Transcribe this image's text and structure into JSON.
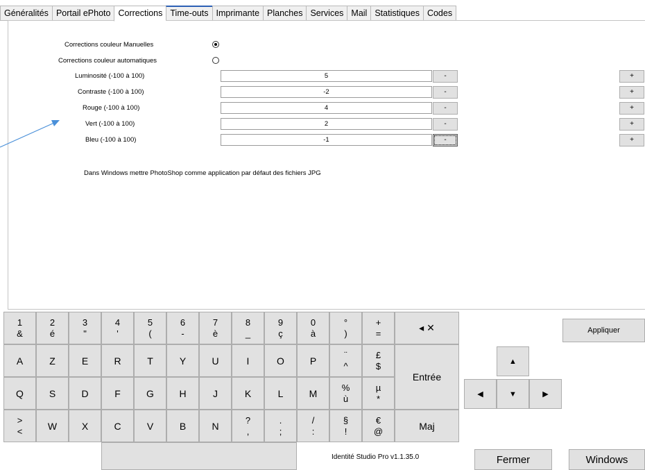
{
  "tabs": [
    {
      "label": "Généralités"
    },
    {
      "label": "Portail ePhoto"
    },
    {
      "label": "Corrections"
    },
    {
      "label": "Time-outs"
    },
    {
      "label": "Imprimante"
    },
    {
      "label": "Planches"
    },
    {
      "label": "Services"
    },
    {
      "label": "Mail"
    },
    {
      "label": "Statistiques"
    },
    {
      "label": "Codes"
    }
  ],
  "active_tab": "Corrections",
  "corrections": {
    "manual_label": "Corrections couleur Manuelles",
    "auto_label": "Corrections couleur automatiques",
    "mode_selected": "manual",
    "rows": [
      {
        "label": "Luminosité (-100 à 100)",
        "value": "5",
        "minus": "-",
        "plus": "+"
      },
      {
        "label": "Contraste (-100 à 100)",
        "value": "-2",
        "minus": "-",
        "plus": "+"
      },
      {
        "label": "Rouge (-100 à 100)",
        "value": "4",
        "minus": "-",
        "plus": "+"
      },
      {
        "label": "Vert (-100 à 100)",
        "value": "2",
        "minus": "-",
        "plus": "+"
      },
      {
        "label": "Bleu (-100 à 100)",
        "value": "-1",
        "minus": "-",
        "plus": "+"
      }
    ],
    "note": "Dans Windows mettre PhotoShop comme application par défaut des fichiers JPG"
  },
  "keyboard": {
    "row1": [
      {
        "top": "1",
        "bottom": "&"
      },
      {
        "top": "2",
        "bottom": "é"
      },
      {
        "top": "3",
        "bottom": "\""
      },
      {
        "top": "4",
        "bottom": "'"
      },
      {
        "top": "5",
        "bottom": "("
      },
      {
        "top": "6",
        "bottom": "-"
      },
      {
        "top": "7",
        "bottom": "è"
      },
      {
        "top": "8",
        "bottom": "_"
      },
      {
        "top": "9",
        "bottom": "ç"
      },
      {
        "top": "0",
        "bottom": "à"
      },
      {
        "top": "°",
        "bottom": ")"
      },
      {
        "top": "+",
        "bottom": "="
      }
    ],
    "backspace": "◂ ✕",
    "row2": [
      "A",
      "Z",
      "E",
      "R",
      "T",
      "Y",
      "U",
      "I",
      "O",
      "P"
    ],
    "row2_extra": [
      {
        "top": "¨",
        "bottom": "^"
      },
      {
        "top": "£",
        "bottom": "$"
      }
    ],
    "row3": [
      "Q",
      "S",
      "D",
      "F",
      "G",
      "H",
      "J",
      "K",
      "L",
      "M"
    ],
    "row3_extra": [
      {
        "top": "%",
        "bottom": "ù"
      },
      {
        "top": "µ",
        "bottom": "*"
      }
    ],
    "enter": "Entrée",
    "row4_first": {
      "top": ">",
      "bottom": "<"
    },
    "row4": [
      "W",
      "X",
      "C",
      "V",
      "B",
      "N"
    ],
    "row4_extra": [
      {
        "top": "?",
        "bottom": ","
      },
      {
        "top": ".",
        "bottom": ";"
      },
      {
        "top": "/",
        "bottom": ":"
      },
      {
        "top": "§",
        "bottom": "!"
      },
      {
        "top": "€",
        "bottom": "@"
      }
    ],
    "shift": "Maj"
  },
  "arrows": {
    "up": "▲",
    "down": "▼",
    "left": "◀",
    "right": "▶"
  },
  "buttons": {
    "apply": "Appliquer",
    "close": "Fermer",
    "windows": "Windows"
  },
  "version": "Identité Studio Pro  v1.1.35.0",
  "colors": {
    "annotation_arrow": "#4a90d9",
    "tab_hover": "#2b5fb4",
    "button_bg": "#e1e1e1"
  }
}
